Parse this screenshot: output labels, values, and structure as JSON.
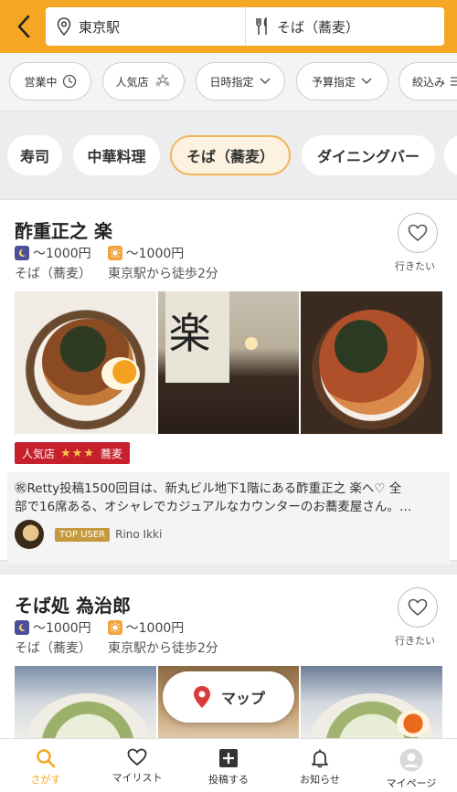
{
  "header": {
    "location": "東京駅",
    "genre": "そば（蕎麦）"
  },
  "filters": [
    {
      "label": "営業中",
      "icon": "clock-icon"
    },
    {
      "label": "人気店",
      "icon": "stars-icon"
    },
    {
      "label": "日時指定",
      "icon": "chevron-down-icon"
    },
    {
      "label": "予算指定",
      "icon": "chevron-down-icon"
    },
    {
      "label": "絞込み",
      "icon": "filter-icon"
    }
  ],
  "categories": [
    {
      "label": "寿司",
      "active": false
    },
    {
      "label": "中華料理",
      "active": false
    },
    {
      "label": "そば（蕎麦）",
      "active": true
    },
    {
      "label": "ダイニングバー",
      "active": false
    }
  ],
  "restaurants": [
    {
      "name": "酢重正之 楽",
      "dinner_price": "〜1000円",
      "lunch_price": "〜1000円",
      "genre": "そば（蕎麦）",
      "access": "東京駅から徒歩2分",
      "wish_label": "行きたい",
      "badge": {
        "label": "人気店",
        "stars": "★★★",
        "tag": "蕎麦"
      },
      "review_line1": "㊗Retty投稿1500回目は、新丸ビル地下1階にある酢重正之 楽へ♡ 全",
      "review_line2": "部で16席ある、オシャレでカジュアルなカウンターのお蕎麦屋さん。…",
      "reviewer_badge": "TOP USER",
      "reviewer_name": "Rino Ikki",
      "photo_text": "楽"
    },
    {
      "name": "そば処 為治郎",
      "dinner_price": "〜1000円",
      "lunch_price": "〜1000円",
      "genre": "そば（蕎麦）",
      "access": "東京駅から徒歩2分",
      "wish_label": "行きたい"
    }
  ],
  "map_button": "マップ",
  "tabs": [
    {
      "label": "さがす",
      "icon": "search-icon",
      "active": true
    },
    {
      "label": "マイリスト",
      "icon": "heart-icon",
      "active": false
    },
    {
      "label": "投稿する",
      "icon": "plus-icon",
      "active": false
    },
    {
      "label": "お知らせ",
      "icon": "bell-icon",
      "active": false
    },
    {
      "label": "マイページ",
      "icon": "user-icon",
      "active": false
    }
  ],
  "colors": {
    "accent": "#f5a623",
    "badge_red": "#c6202d",
    "top_user_gold": "#c59a3c",
    "moon_blue": "#4b4f9a",
    "sun_orange": "#f2a33a"
  }
}
